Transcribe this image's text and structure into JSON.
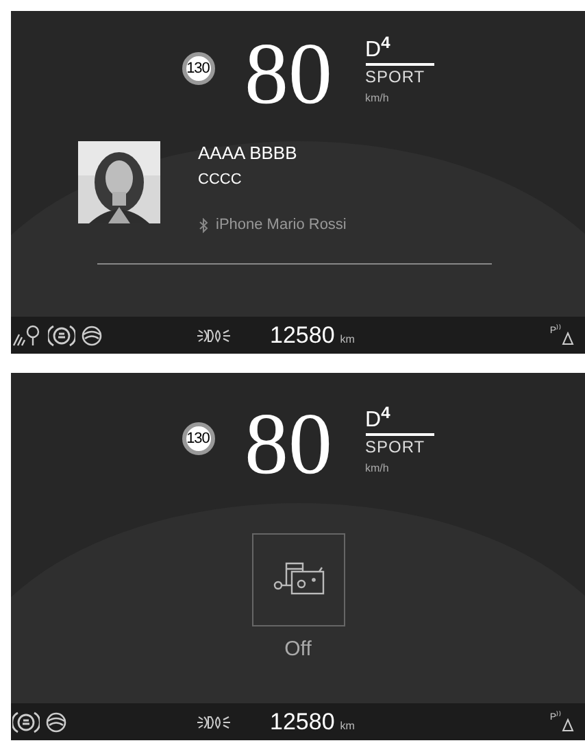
{
  "screens": [
    {
      "speed_limit": "130",
      "speed": "80",
      "gear": "D$^{4}$",
      "mode": "SPORT",
      "unit": "km/h",
      "content": {
        "kind": "contact",
        "name": "AAAA BBBB",
        "line_2": "CCCC",
        "device": "iPhone Mario Rossi"
      },
      "indicators": [
        {
          "kind": "lamp"
        },
        {
          "kind": "brake"
        },
        {
          "kind": "wheel"
        }
      ],
      "odometer": "12580",
      "odometer_unit": "km",
      "sensor": "P⁾⁾"
    },
    {
      "speed_limit": "130",
      "speed": "80",
      "gear": "D$^{4}$",
      "mode": "SPORT",
      "unit": "km/h",
      "content": {
        "kind": "feature",
        "state": "Off"
      },
      "indicators": [
        {
          "kind": "brake"
        },
        {
          "kind": "wheel"
        }
      ],
      "odometer": "12580",
      "odometer_unit": "km",
      "sensor": "P⁾⁾"
    }
  ]
}
